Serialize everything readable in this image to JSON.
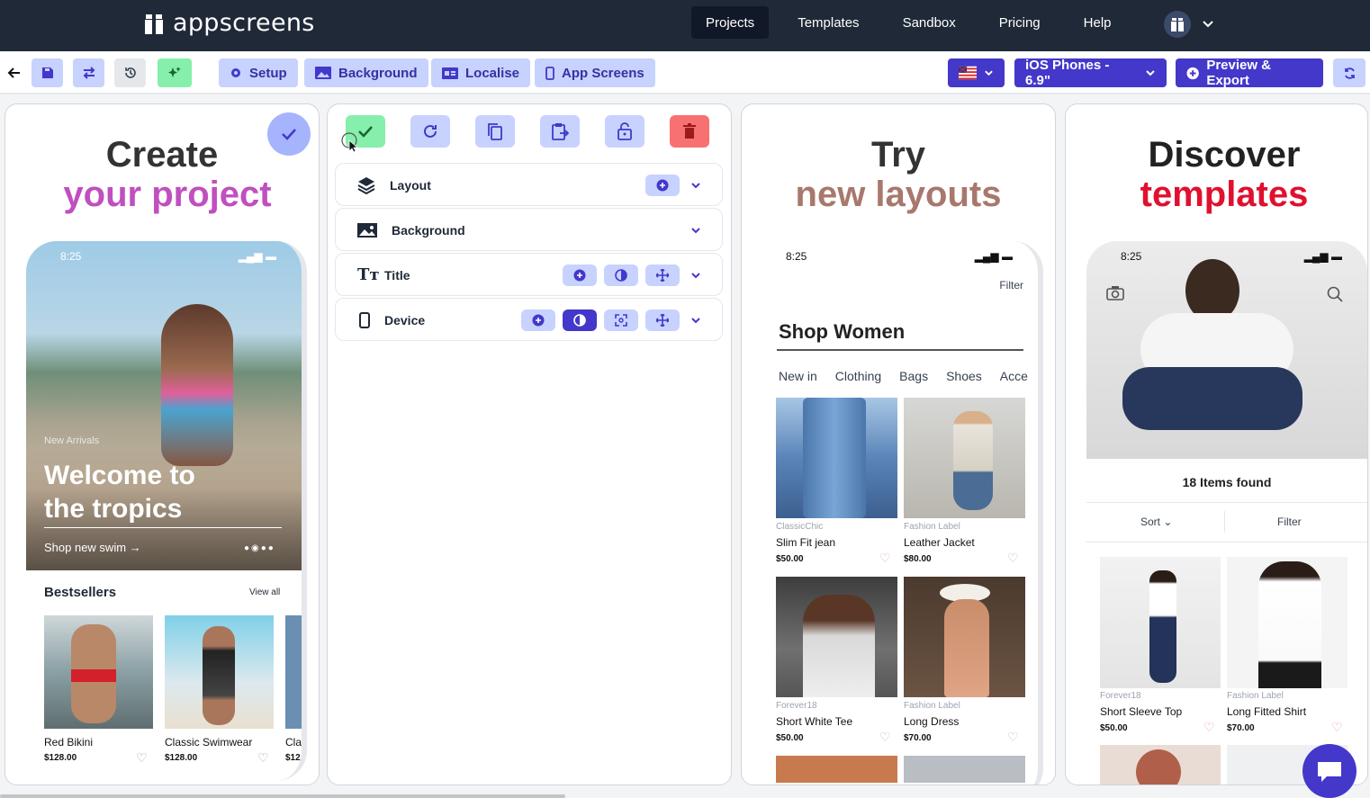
{
  "brand": {
    "name": "appscreens"
  },
  "nav": {
    "items": [
      "Projects",
      "Templates",
      "Sandbox",
      "Pricing",
      "Help"
    ]
  },
  "toolbar": {
    "setup": "Setup",
    "background": "Background",
    "localise": "Localise",
    "app_screens": "App Screens",
    "device": "iOS Phones - 6.9\"",
    "export": "Preview & Export"
  },
  "editor": {
    "sections": [
      "Layout",
      "Background",
      "Title",
      "Device"
    ]
  },
  "screen1": {
    "title_line1": "Create",
    "title_line2": "your project",
    "accent": "#c04fc0",
    "time": "8:25",
    "hero_kicker": "New Arrivals",
    "hero_title_1": "Welcome to",
    "hero_title_2": "the tropics",
    "hero_cta": "Shop new swim",
    "section_title": "Bestsellers",
    "view_all": "View all",
    "products": [
      {
        "name": "Red Bikini",
        "price": "$128.00"
      },
      {
        "name": "Classic Swimwear",
        "price": "$128.00"
      },
      {
        "name": "Cla",
        "price": "$12"
      }
    ]
  },
  "screen2": {
    "title_line1": "Try",
    "title_line2": "new layouts",
    "accent": "#a8786c",
    "time": "8:25",
    "filter": "Filter",
    "heading": "Shop Women",
    "categories": [
      "New in",
      "Clothing",
      "Bags",
      "Shoes",
      "Acce"
    ],
    "products": [
      {
        "brand": "ClassicChic",
        "name": "Slim Fit jean",
        "price": "$50.00"
      },
      {
        "brand": "Fashion Label",
        "name": "Leather Jacket",
        "price": "$80.00"
      },
      {
        "brand": "Forever18",
        "name": "Short White Tee",
        "price": "$50.00"
      },
      {
        "brand": "Fashion Label",
        "name": "Long Dress",
        "price": "$70.00"
      }
    ]
  },
  "screen3": {
    "title_line1": "Discover",
    "title_line2": "templates",
    "accent": "#e0102f",
    "time": "8:25",
    "found": "18 Items found",
    "sort": "Sort",
    "filter": "Filter",
    "products": [
      {
        "brand": "Forever18",
        "name": "Short Sleeve Top",
        "price": "$50.00"
      },
      {
        "brand": "Fashion Label",
        "name": "Long Fitted Shirt",
        "price": "$70.00"
      }
    ]
  },
  "colors": {
    "nav_bg": "#1f2937",
    "accent": "#4338ca",
    "accent_light": "#c7d2fe",
    "success": "#86efac",
    "danger": "#f87171"
  },
  "icons": [
    "back-icon",
    "save-icon",
    "swap-icon",
    "history-icon",
    "magic-icon",
    "gear-icon",
    "image-icon",
    "id-card-icon",
    "phone-icon",
    "flag-icon",
    "plus-circle-icon",
    "refresh-icon",
    "check-icon",
    "copy-icon",
    "paste-icon",
    "lock-icon",
    "trash-icon",
    "layers-icon",
    "text-icon",
    "contrast-icon",
    "move-icon",
    "expand-icon",
    "chevron-down-icon",
    "chat-icon"
  ]
}
